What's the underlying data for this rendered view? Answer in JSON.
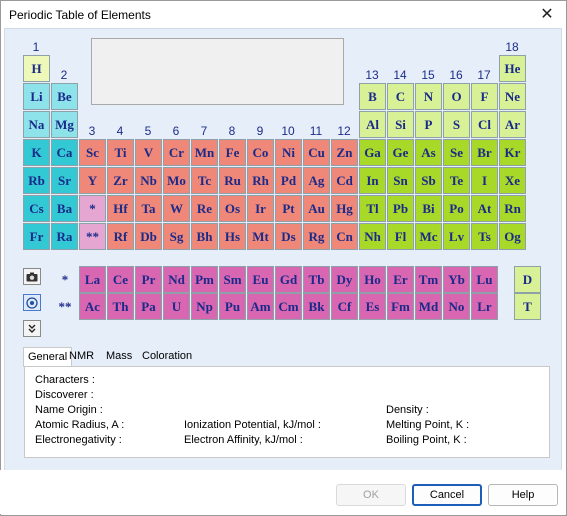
{
  "window": {
    "title": "Periodic Table of Elements",
    "close_icon": "close-icon"
  },
  "colors": {
    "s_block": "#32c8d4",
    "s_block_light": "#8ee3eb",
    "d_block": "#ef8878",
    "d_block_light": "#f6c6b4",
    "p_block": "#a8d828",
    "p_block_light": "#d8f096",
    "noble": "#a8d828",
    "f_block": "#d866b0",
    "f_marker": "#e6a6d2",
    "hydrogen": "#eef8b8"
  },
  "group_numbers": [
    "1",
    "2",
    "3",
    "4",
    "5",
    "6",
    "7",
    "8",
    "9",
    "10",
    "11",
    "12",
    "13",
    "14",
    "15",
    "16",
    "17",
    "18"
  ],
  "periods": {
    "p1": [
      "H",
      "He"
    ],
    "p2": [
      "Li",
      "Be",
      "B",
      "C",
      "N",
      "O",
      "F",
      "Ne"
    ],
    "p3": [
      "Na",
      "Mg",
      "Al",
      "Si",
      "P",
      "S",
      "Cl",
      "Ar"
    ],
    "p4": [
      "K",
      "Ca",
      "Sc",
      "Ti",
      "V",
      "Cr",
      "Mn",
      "Fe",
      "Co",
      "Ni",
      "Cu",
      "Zn",
      "Ga",
      "Ge",
      "As",
      "Se",
      "Br",
      "Kr"
    ],
    "p5": [
      "Rb",
      "Sr",
      "Y",
      "Zr",
      "Nb",
      "Mo",
      "Tc",
      "Ru",
      "Rh",
      "Pd",
      "Ag",
      "Cd",
      "In",
      "Sn",
      "Sb",
      "Te",
      "I",
      "Xe"
    ],
    "p6": [
      "Cs",
      "Ba",
      "*",
      "Hf",
      "Ta",
      "W",
      "Re",
      "Os",
      "Ir",
      "Pt",
      "Au",
      "Hg",
      "Tl",
      "Pb",
      "Bi",
      "Po",
      "At",
      "Rn"
    ],
    "p7": [
      "Fr",
      "Ra",
      "**",
      "Rf",
      "Db",
      "Sg",
      "Bh",
      "Hs",
      "Mt",
      "Ds",
      "Rg",
      "Cn",
      "Nh",
      "Fl",
      "Mc",
      "Lv",
      "Ts",
      "Og"
    ]
  },
  "lanthanides": {
    "marker": "*",
    "elements": [
      "La",
      "Ce",
      "Pr",
      "Nd",
      "Pm",
      "Sm",
      "Eu",
      "Gd",
      "Tb",
      "Dy",
      "Ho",
      "Er",
      "Tm",
      "Yb",
      "Lu"
    ]
  },
  "actinides": {
    "marker": "**",
    "elements": [
      "Ac",
      "Th",
      "Pa",
      "U",
      "Np",
      "Pu",
      "Am",
      "Cm",
      "Bk",
      "Cf",
      "Es",
      "Fm",
      "Md",
      "No",
      "Lr"
    ]
  },
  "isotopes": [
    "D",
    "T"
  ],
  "toolbar": {
    "icons": [
      "camera-icon",
      "atom-icon",
      "chevron-double-down-icon"
    ]
  },
  "tabs": [
    "General",
    "NMR",
    "Mass",
    "Coloration"
  ],
  "active_tab": "General",
  "properties": {
    "characters": "Characters :",
    "discoverer": "Discoverer :",
    "name_origin": "Name Origin :",
    "density": "Density :",
    "atomic_radius": "Atomic Radius, A :",
    "ionization": "Ionization Potential, kJ/mol :",
    "melting": "Melting Point, K :",
    "electronegativity": "Electronegativity :",
    "electron_affinity": "Electron Affinity, kJ/mol :",
    "boiling": "Boiling Point, K :"
  },
  "buttons": {
    "ok": "OK",
    "cancel": "Cancel",
    "help": "Help"
  }
}
